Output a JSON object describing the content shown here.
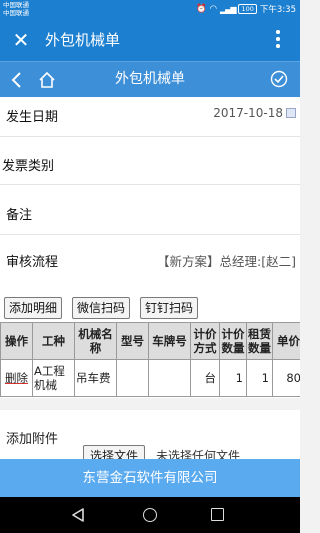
{
  "status_bar": {
    "carrier_1": "中国联通",
    "carrier_2": "中国联通",
    "battery": "100",
    "time": "下午3:35"
  },
  "app_bar": {
    "title": "外包机械单"
  },
  "sub_header": {
    "title": "外包机械单"
  },
  "form": {
    "occur_date_label": "发生日期",
    "occur_date_value": "2017-10-18",
    "invoice_type_label": "发票类别",
    "remark_label": "备注",
    "approval_flow_label": "审核流程",
    "approval_flow_value": "【新方案】总经理:[赵二]"
  },
  "toolbar": {
    "add_detail": "添加明细",
    "wechat_scan": "微信扫码",
    "dingding_scan": "钉钉扫码"
  },
  "detail_table": {
    "headers": [
      "操作",
      "工种",
      "机械名称",
      "型号",
      "车牌号",
      "计价方式",
      "计价数量",
      "租赁数量",
      "单价"
    ],
    "rows": [
      {
        "action": "删除",
        "work_type": "A工程机械",
        "machine_name": "吊车费",
        "model": "",
        "plate": "",
        "pricing_method": "台",
        "pricing_qty": "1",
        "lease_qty": "1",
        "unit_price": "80"
      }
    ]
  },
  "attachments": {
    "label": "添加附件",
    "choose_file": "选择文件",
    "no_file": "未选择任何文件"
  },
  "footer": {
    "company": "东营金石软件有限公司"
  },
  "colors": {
    "primary": "#1d7fd0",
    "subheader": "#3d8fd8",
    "footer": "#5aaaf0"
  }
}
